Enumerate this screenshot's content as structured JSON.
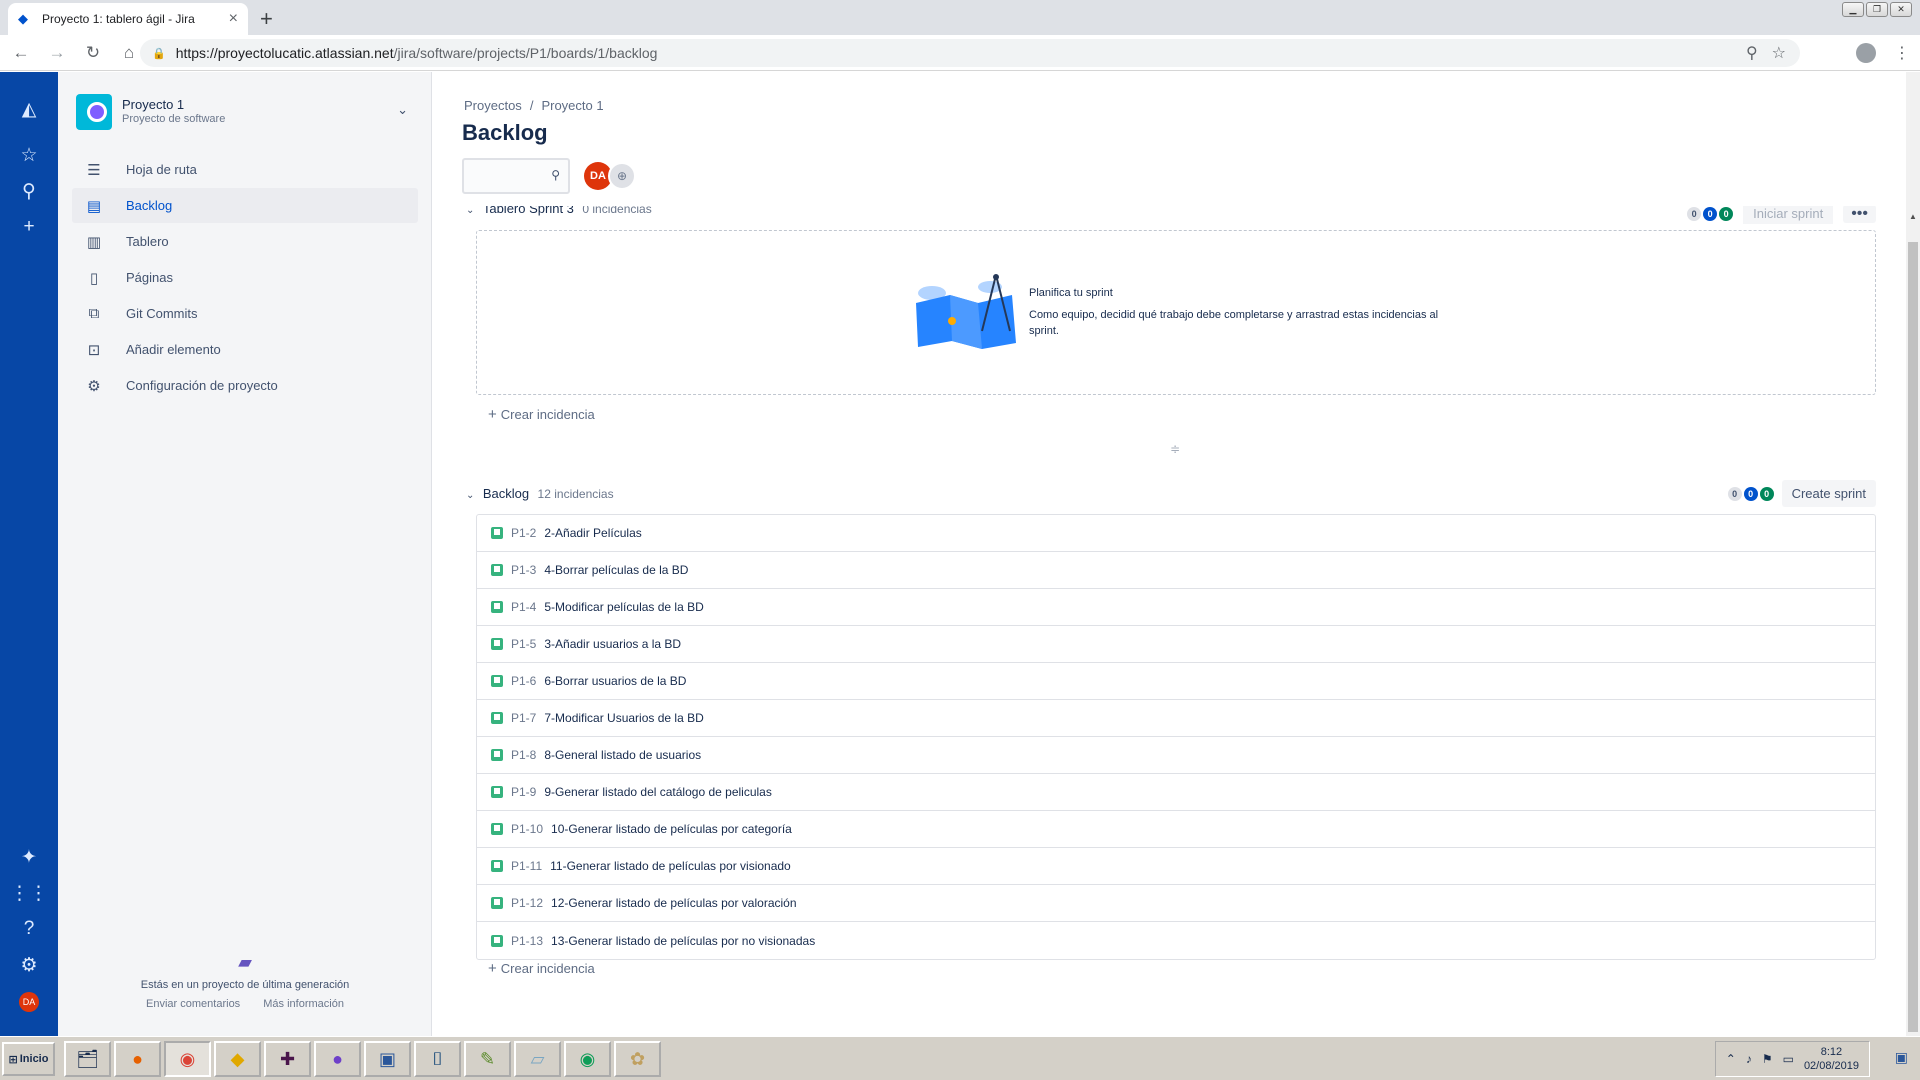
{
  "browser": {
    "tab_title": "Proyecto 1: tablero ágil - Jira",
    "url_host": "https://proyectolucatic.atlassian.net",
    "url_path": "/jira/software/projects/P1/boards/1/backlog"
  },
  "sidebar": {
    "project_name": "Proyecto 1",
    "project_type": "Proyecto de software",
    "items": [
      {
        "label": "Hoja de ruta",
        "icon": "roadmap-icon"
      },
      {
        "label": "Backlog",
        "icon": "backlog-icon"
      },
      {
        "label": "Tablero",
        "icon": "board-icon"
      },
      {
        "label": "Páginas",
        "icon": "pages-icon"
      },
      {
        "label": "Git Commits",
        "icon": "git-commits-icon"
      },
      {
        "label": "Añadir elemento",
        "icon": "add-item-icon"
      },
      {
        "label": "Configuración de proyecto",
        "icon": "settings-icon"
      }
    ],
    "footer_text": "Estás en un proyecto de última generación",
    "footer_link_feedback": "Enviar comentarios",
    "footer_link_more": "Más información"
  },
  "global_nav": {
    "avatar_initials": "DA"
  },
  "main": {
    "breadcrumb_1": "Proyectos",
    "breadcrumb_sep": "/",
    "breadcrumb_2": "Proyecto 1",
    "title": "Backlog",
    "avatar_initials": "DA"
  },
  "sprint": {
    "title": "Tablero Sprint 3",
    "count": "0 incidencias",
    "lozenges": [
      "0",
      "0",
      "0"
    ],
    "start_button": "Iniciar sprint",
    "empty_title": "Planifica tu sprint",
    "empty_text": "Como equipo, decidid qué trabajo debe completarse y arrastrad estas incidencias al sprint.",
    "create_issue": "Crear incidencia"
  },
  "backlog": {
    "title": "Backlog",
    "count": "12 incidencias",
    "lozenges": [
      "0",
      "0",
      "0"
    ],
    "create_sprint": "Create sprint",
    "create_issue": "Crear incidencia",
    "issues": [
      {
        "key": "P1-2",
        "summary": "2-Añadir Películas"
      },
      {
        "key": "P1-3",
        "summary": "4-Borrar películas de la BD"
      },
      {
        "key": "P1-4",
        "summary": "5-Modificar películas de la BD"
      },
      {
        "key": "P1-5",
        "summary": "3-Añadir usuarios a la BD"
      },
      {
        "key": "P1-6",
        "summary": "6-Borrar usuarios de la BD"
      },
      {
        "key": "P1-7",
        "summary": "7-Modificar Usuarios de la BD"
      },
      {
        "key": "P1-8",
        "summary": "8-General listado de usuarios"
      },
      {
        "key": "P1-9",
        "summary": "9-Generar listado del catálogo de peliculas"
      },
      {
        "key": "P1-10",
        "summary": "10-Generar listado de películas por categoría"
      },
      {
        "key": "P1-11",
        "summary": "11-Generar listado de películas por visionado"
      },
      {
        "key": "P1-12",
        "summary": "12-Generar listado de películas por valoración"
      },
      {
        "key": "P1-13",
        "summary": "13-Generar listado de películas por no visionadas"
      }
    ]
  },
  "taskbar": {
    "start": "Inicio",
    "time": "8:12",
    "date": "02/08/2019"
  },
  "colors": {
    "global_nav": "#0747a6",
    "accent": "#0052cc",
    "story": "#36b37e",
    "avatar": "#de350b"
  }
}
